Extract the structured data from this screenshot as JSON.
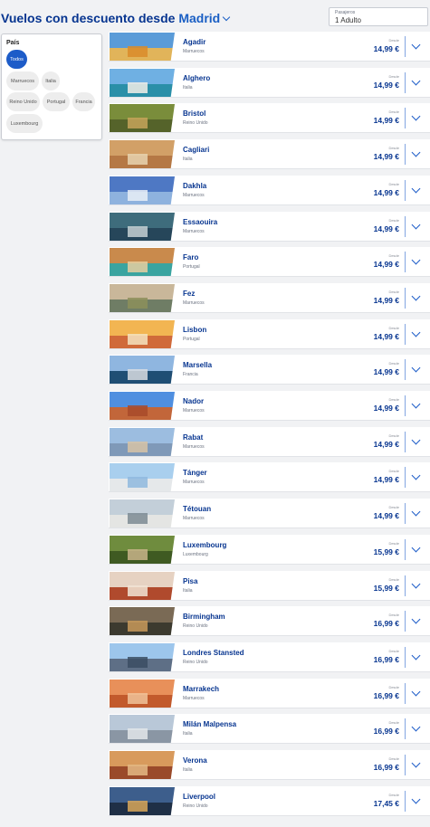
{
  "header": {
    "title_prefix": "Vuelos con descuento desde",
    "origin_city": "Madrid",
    "passengers_label": "Pasajeros",
    "passengers_value": "1 Adulto"
  },
  "filter": {
    "heading": "País",
    "chips": [
      "Todos",
      "Marruecos",
      "Italia",
      "Reino Unido",
      "Portugal",
      "Francia",
      "Luxembourg"
    ],
    "active_chip": "Todos"
  },
  "price_prefix": "Desde",
  "destinations": [
    {
      "city": "Agadir",
      "country": "Marruecos",
      "price": "14,99 €",
      "sky": "#5a9bd8",
      "ground": "#e1b45a",
      "feat": "#d98b2a"
    },
    {
      "city": "Alghero",
      "country": "Italia",
      "price": "14,99 €",
      "sky": "#6fb0e3",
      "ground": "#2a8fa8",
      "feat": "#f2efe8"
    },
    {
      "city": "Bristol",
      "country": "Reino Unido",
      "price": "14,99 €",
      "sky": "#7a8d3b",
      "ground": "#55632a",
      "feat": "#c7a35a"
    },
    {
      "city": "Cagliari",
      "country": "Italia",
      "price": "14,99 €",
      "sky": "#d2a067",
      "ground": "#b57845",
      "feat": "#e8d3b0"
    },
    {
      "city": "Dakhla",
      "country": "Marruecos",
      "price": "14,99 €",
      "sky": "#4e78c4",
      "ground": "#8eb2de",
      "feat": "#e9eef7"
    },
    {
      "city": "Essaouira",
      "country": "Marruecos",
      "price": "14,99 €",
      "sky": "#3e6c7c",
      "ground": "#26465a",
      "feat": "#c5d0d3"
    },
    {
      "city": "Faro",
      "country": "Portugal",
      "price": "14,99 €",
      "sky": "#c98a4c",
      "ground": "#3aa4a0",
      "feat": "#e6cfa0"
    },
    {
      "city": "Fez",
      "country": "Marruecos",
      "price": "14,99 €",
      "sky": "#c9b79a",
      "ground": "#6f7d65",
      "feat": "#8d8f5a"
    },
    {
      "city": "Lisbon",
      "country": "Portugal",
      "price": "14,99 €",
      "sky": "#f2b552",
      "ground": "#d06a3a",
      "feat": "#f4e3c0"
    },
    {
      "city": "Marsella",
      "country": "Francia",
      "price": "14,99 €",
      "sky": "#8fb6e0",
      "ground": "#1f4e74",
      "feat": "#d9dde2"
    },
    {
      "city": "Nador",
      "country": "Marruecos",
      "price": "14,99 €",
      "sky": "#4f8fe0",
      "ground": "#c2663a",
      "feat": "#a84a2a"
    },
    {
      "city": "Rabat",
      "country": "Marruecos",
      "price": "14,99 €",
      "sky": "#9cbde0",
      "ground": "#7f99b8",
      "feat": "#d7c3a6"
    },
    {
      "city": "Tánger",
      "country": "Marruecos",
      "price": "14,99 €",
      "sky": "#a9cfee",
      "ground": "#e5e8ea",
      "feat": "#8fb8de"
    },
    {
      "city": "Tétouan",
      "country": "Marruecos",
      "price": "14,99 €",
      "sky": "#c3cfd9",
      "ground": "#e4e5e3",
      "feat": "#7d8b93"
    },
    {
      "city": "Luxembourg",
      "country": "Luxembourg",
      "price": "15,99 €",
      "sky": "#6f8c3e",
      "ground": "#3f5a22",
      "feat": "#c9b48a"
    },
    {
      "city": "Pisa",
      "country": "Italia",
      "price": "15,99 €",
      "sky": "#e6d2c2",
      "ground": "#b04a2d",
      "feat": "#f1e4d5"
    },
    {
      "city": "Birmingham",
      "country": "Reino Unido",
      "price": "16,99 €",
      "sky": "#7a6a55",
      "ground": "#3c3a2f",
      "feat": "#c89a5a"
    },
    {
      "city": "Londres Stansted",
      "country": "Reino Unido",
      "price": "16,99 €",
      "sky": "#9dc6ec",
      "ground": "#5e6f86",
      "feat": "#3b4d63"
    },
    {
      "city": "Marrakech",
      "country": "Marruecos",
      "price": "16,99 €",
      "sky": "#e8905a",
      "ground": "#c25a2c",
      "feat": "#f0c39a"
    },
    {
      "city": "Milán Malpensa",
      "country": "Italia",
      "price": "16,99 €",
      "sky": "#b9c8d8",
      "ground": "#8a96a4",
      "feat": "#e2e6ea"
    },
    {
      "city": "Verona",
      "country": "Italia",
      "price": "16,99 €",
      "sky": "#d89a5c",
      "ground": "#9a4a2a",
      "feat": "#e4b884"
    },
    {
      "city": "Liverpool",
      "country": "Reino Unido",
      "price": "17,45 €",
      "sky": "#3d5e8c",
      "ground": "#1f2f46",
      "feat": "#d9a75a"
    }
  ]
}
